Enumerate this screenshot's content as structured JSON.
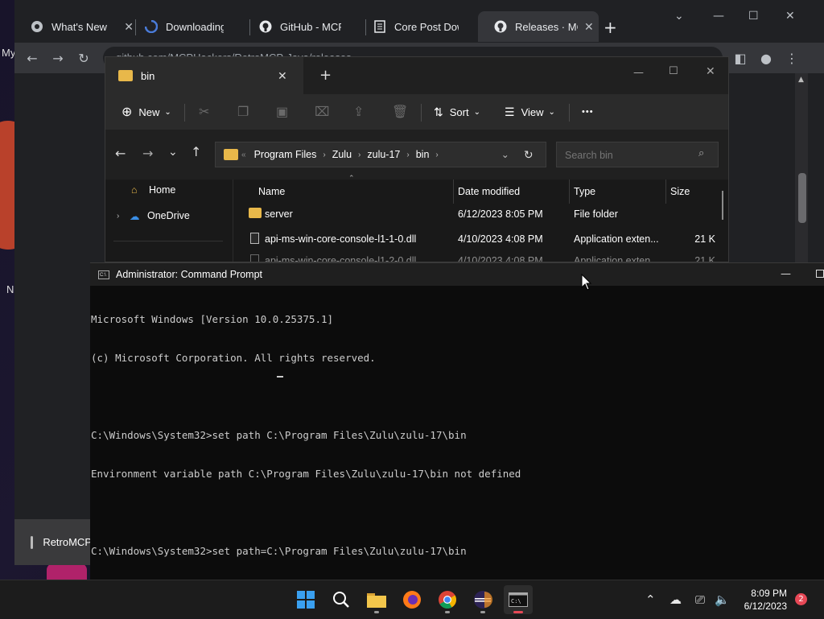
{
  "desktop": {
    "letters": [
      "My",
      "N"
    ]
  },
  "chrome": {
    "tabs": [
      {
        "label": "What's New",
        "icon": "chrome-icon"
      },
      {
        "label": "Downloading (",
        "icon": "loading-icon"
      },
      {
        "label": "GitHub - MCPH",
        "icon": "github-icon"
      },
      {
        "label": "Core Post Dow",
        "icon": "document-icon"
      },
      {
        "label": "Releases · MCPH",
        "icon": "github-icon"
      }
    ],
    "url": "github.com/MCPHackers/RetroMCP-Java/releases",
    "sidebar_item_label": "RetroMCP"
  },
  "explorer": {
    "tab_title": "bin",
    "cmd": {
      "new": "New",
      "sort": "Sort",
      "view": "View",
      "more": "•••"
    },
    "breadcrumb": [
      "Program Files",
      "Zulu",
      "zulu-17",
      "bin"
    ],
    "search_placeholder": "Search bin",
    "nav": {
      "home": "Home",
      "onedrive": "OneDrive"
    },
    "columns": {
      "name": "Name",
      "date": "Date modified",
      "type": "Type",
      "size": "Size"
    },
    "files": [
      {
        "name": "server",
        "date": "6/12/2023 8:05 PM",
        "type": "File folder",
        "size": ""
      },
      {
        "name": "api-ms-win-core-console-l1-1-0.dll",
        "date": "4/10/2023 4:08 PM",
        "type": "Application exten...",
        "size": "21 K"
      },
      {
        "name": "api-ms-win-core-console-l1-2-0.dll",
        "date": "4/10/2023 4:08 PM",
        "type": "Application exten...",
        "size": "21 K"
      }
    ]
  },
  "cmd": {
    "title": "Administrator: Command Prompt",
    "lines": [
      "Microsoft Windows [Version 10.0.25375.1]",
      "(c) Microsoft Corporation. All rights reserved.",
      "",
      "C:\\Windows\\System32>set path C:\\Program Files\\Zulu\\zulu-17\\bin",
      "Environment variable path C:\\Program Files\\Zulu\\zulu-17\\bin not defined",
      "",
      "C:\\Windows\\System32>set path=C:\\Program Files\\Zulu\\zulu-17\\bin"
    ]
  },
  "taskbar": {
    "apps": [
      "start-icon",
      "search-icon",
      "file-explorer-icon",
      "firefox-icon",
      "chrome-icon",
      "eclipse-icon",
      "terminal-icon"
    ],
    "time": "8:09 PM",
    "date": "6/12/2023",
    "notifications": "2"
  },
  "colors": {
    "accent": "#0078d4",
    "folder": "#e8b84a",
    "cmd_text": "#cccccc"
  }
}
